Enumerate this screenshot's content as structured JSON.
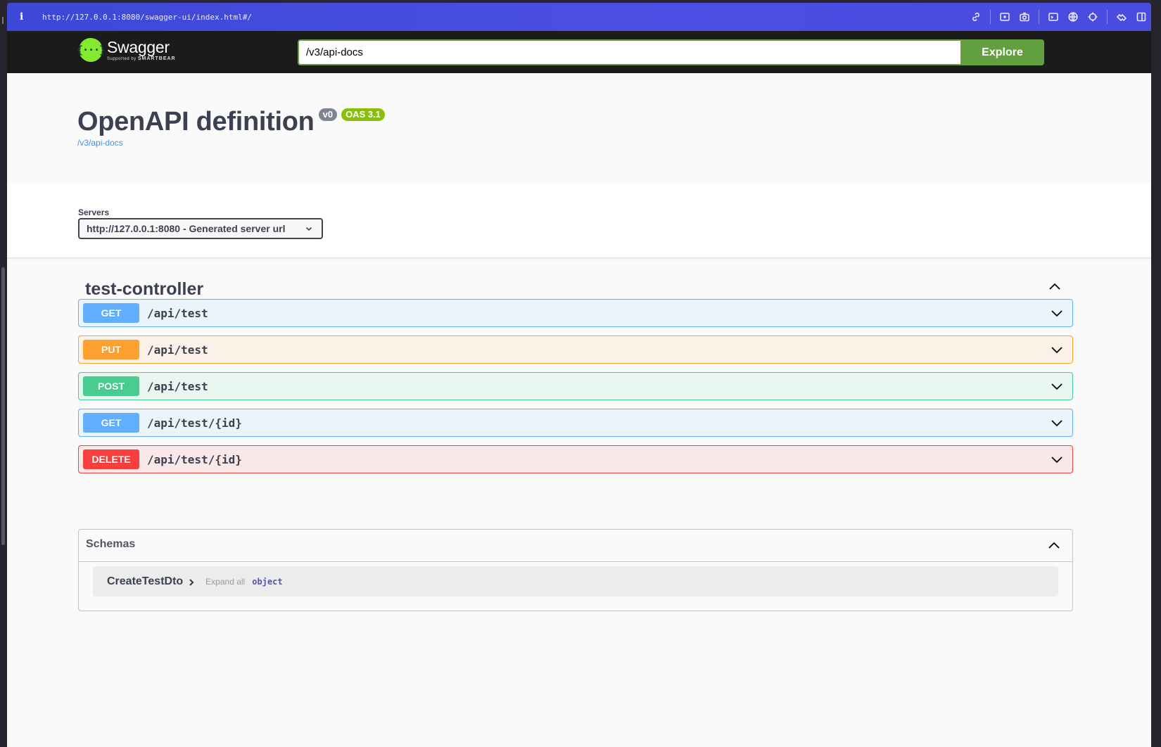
{
  "browser": {
    "url": "http://127.0.0.1:8080/swagger-ui/index.html#/",
    "icons": [
      "link-icon",
      "screenshot-area-icon",
      "camera-icon",
      "terminal-icon",
      "globe-icon",
      "crosshair-icon",
      "extension-icon",
      "sidebar-icon"
    ]
  },
  "topbar": {
    "logo_name": "Swagger",
    "logo_sub_prefix": "Supported by",
    "logo_sub_brand": "SMARTBEAR",
    "spec_url": "/v3/api-docs",
    "explore_label": "Explore"
  },
  "info": {
    "title": "OpenAPI definition",
    "version_badge": "v0",
    "oas_badge": "OAS 3.1",
    "spec_link": "/v3/api-docs"
  },
  "servers": {
    "label": "Servers",
    "selected": "http://127.0.0.1:8080 - Generated server url"
  },
  "tag": {
    "name": "test-controller",
    "operations": [
      {
        "method": "GET",
        "path": "/api/test"
      },
      {
        "method": "PUT",
        "path": "/api/test"
      },
      {
        "method": "POST",
        "path": "/api/test"
      },
      {
        "method": "GET",
        "path": "/api/test/{id}"
      },
      {
        "method": "DELETE",
        "path": "/api/test/{id}"
      }
    ]
  },
  "schemas": {
    "title": "Schemas",
    "items": [
      {
        "name": "CreateTestDto",
        "expand_label": "Expand all",
        "type": "object"
      }
    ]
  },
  "colors": {
    "get": "#61affe",
    "put": "#fca130",
    "post": "#49cc90",
    "delete": "#f93e3e",
    "explore": "#62a03f"
  }
}
